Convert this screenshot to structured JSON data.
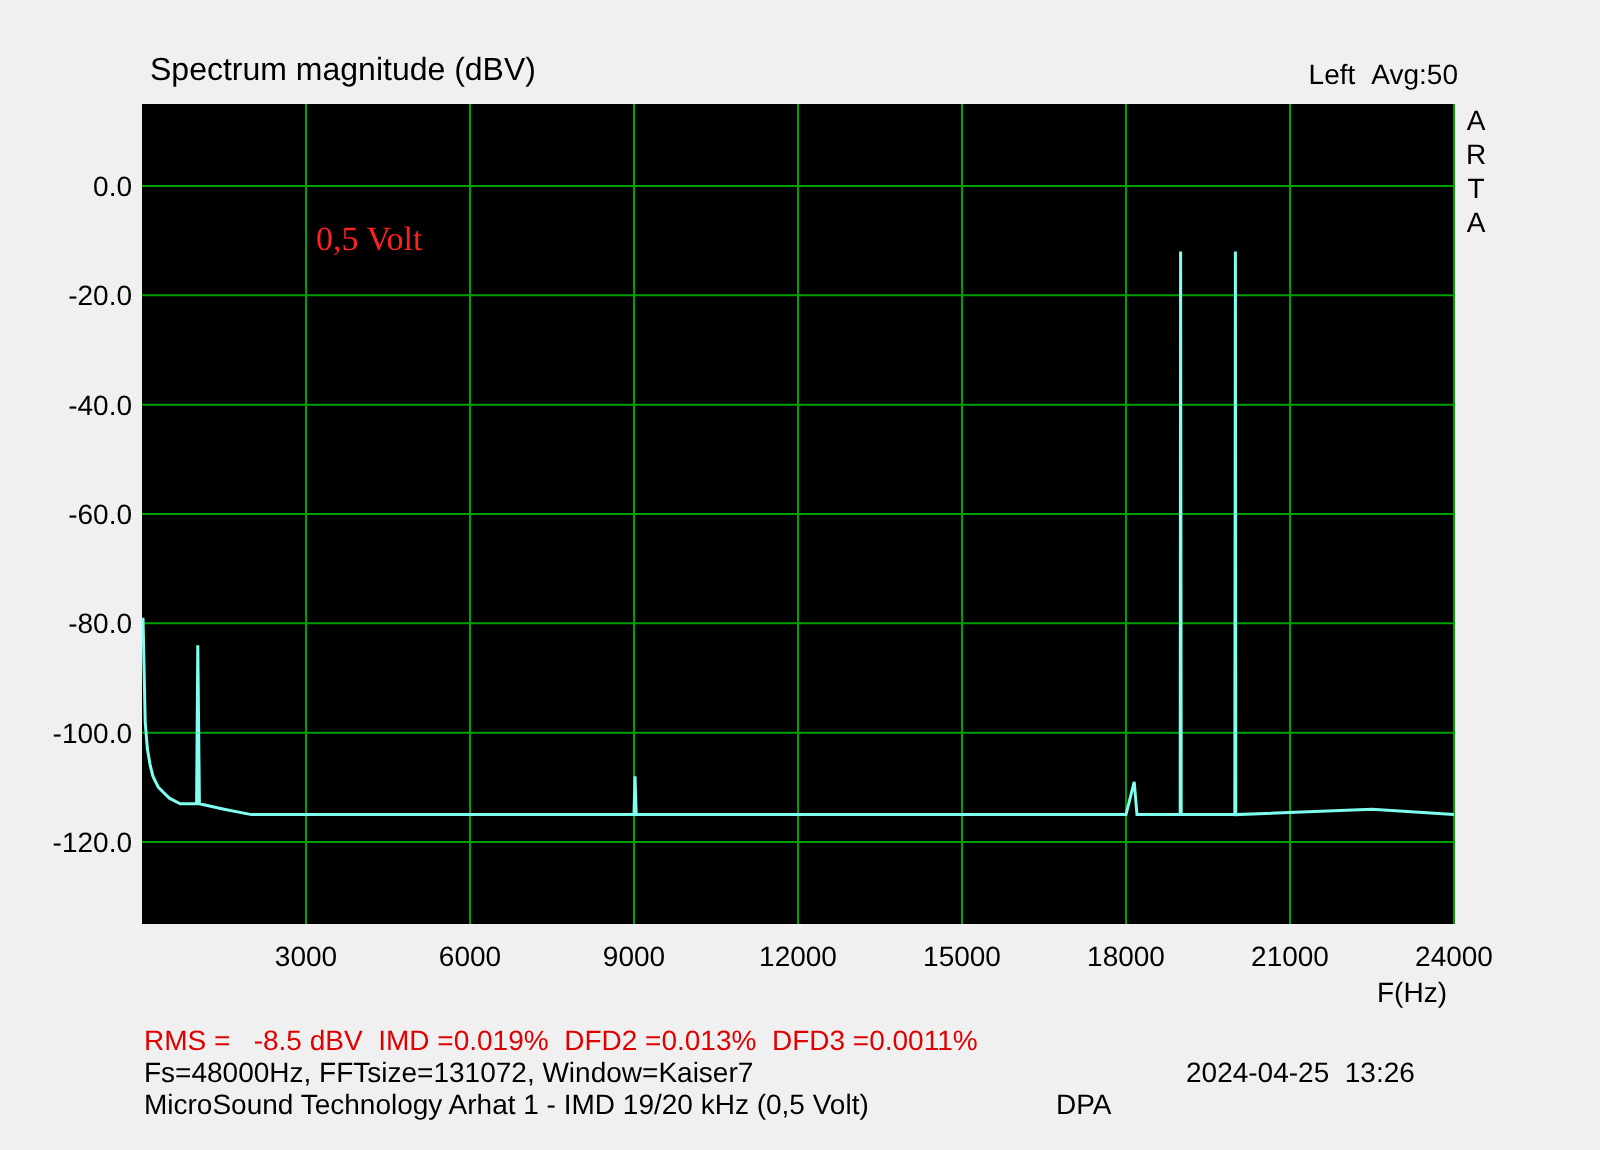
{
  "header": {
    "title": "Spectrum magnitude (dBV)",
    "average": "Avg:50"
  },
  "brand": "ARTA",
  "chart_data": {
    "type": "line",
    "grid": true,
    "xlabel": "F(Hz)",
    "xlim": [
      0,
      24000
    ],
    "ylim": [
      -135,
      15
    ],
    "xticks": [
      3000,
      6000,
      9000,
      12000,
      15000,
      18000,
      21000,
      24000
    ],
    "yticks": [
      {
        "value": 0,
        "label": "0.0"
      },
      {
        "value": -20,
        "label": "-20.0"
      },
      {
        "value": -40,
        "label": "-40.0"
      },
      {
        "value": -60,
        "label": "-60.0"
      },
      {
        "value": -80,
        "label": "-80.0"
      },
      {
        "value": -100,
        "label": "-100.0"
      },
      {
        "value": -120,
        "label": "-120.0"
      }
    ],
    "x": [
      20,
      60,
      100,
      150,
      200,
      300,
      400,
      500,
      700,
      1000,
      1020,
      1050,
      1500,
      2000,
      3000,
      5000,
      9000,
      9020,
      9040,
      12000,
      15000,
      18000,
      18150,
      18200,
      18250,
      18990,
      19000,
      19010,
      19990,
      20000,
      20010,
      22500,
      24000
    ],
    "series": [
      {
        "name": "Left",
        "color": "#7fffef",
        "values": [
          -79,
          -98,
          -103,
          -106,
          -108,
          -110,
          -111,
          -112,
          -113,
          -113,
          -84,
          -113,
          -114,
          -115,
          -115,
          -115,
          -115,
          -108,
          -115,
          -115,
          -115,
          -115,
          -109,
          -115,
          -115,
          -115,
          -12,
          -115,
          -115,
          -12,
          -115,
          -114,
          -115
        ]
      }
    ],
    "annotations": [
      "0,5 Volt"
    ]
  },
  "footer": {
    "measurements": "RMS =   -8.5 dBV  IMD =0.019%  DFD2 =0.013%  DFD3 =0.0011%",
    "settings": "Fs=48000Hz, FFTsize=131072, Window=Kaiser7",
    "timestamp": "2024-04-25  13:26",
    "description": "MicroSound Technology Arhat 1 - IMD 19/20 kHz (0,5 Volt)",
    "device": "DPA"
  }
}
